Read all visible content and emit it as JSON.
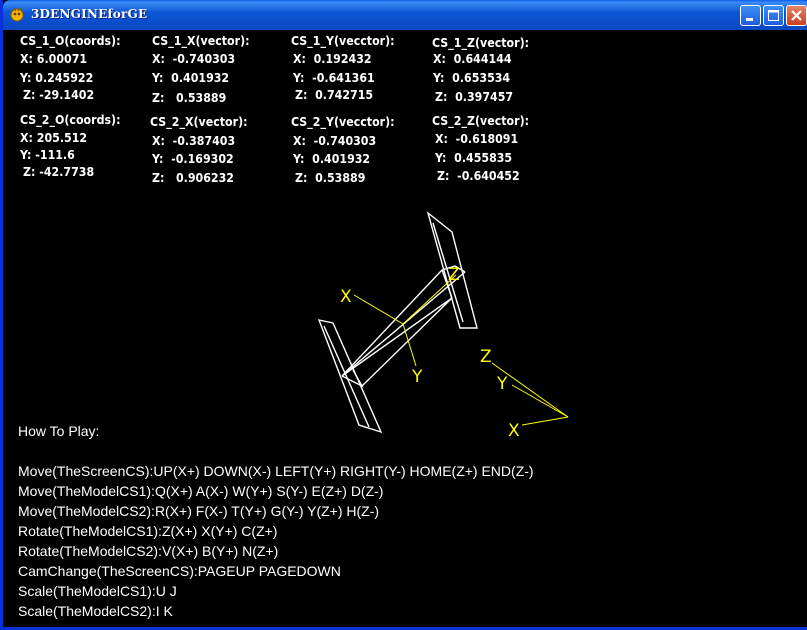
{
  "window": {
    "title": "3DENGINEforGE"
  },
  "colors": {
    "titlebar": "#0a4cc8",
    "background": "#000000",
    "text": "#ffffff",
    "axis": "#ffff00"
  },
  "icons": {
    "app": "game-controller-icon",
    "minimize": "minimize-icon",
    "maximize": "maximize-icon",
    "close": "close-icon"
  },
  "coord_systems": [
    {
      "blocks": [
        {
          "header": "CS_1_O(coords):",
          "rows": [
            {
              "axis": "X:",
              "value": "6.00071"
            },
            {
              "axis": "Y:",
              "value": "0.245922"
            },
            {
              "axis": "Z:",
              "value": "-29.1402"
            }
          ]
        },
        {
          "header": "CS_1_X(vector):",
          "rows": [
            {
              "axis": "X:",
              "value": "-0.740303"
            },
            {
              "axis": "Y:",
              "value": "0.401932"
            },
            {
              "axis": "Z:",
              "value": "0.53889"
            }
          ]
        },
        {
          "header": "CS_1_Y(vecctor):",
          "rows": [
            {
              "axis": "X:",
              "value": "0.192432"
            },
            {
              "axis": "Y:",
              "value": "-0.641361"
            },
            {
              "axis": "Z:",
              "value": "0.742715"
            }
          ]
        },
        {
          "header": "CS_1_Z(vector):",
          "rows": [
            {
              "axis": "X:",
              "value": "0.644144"
            },
            {
              "axis": "Y:",
              "value": "0.653534"
            },
            {
              "axis": "Z:",
              "value": "0.397457"
            }
          ]
        }
      ]
    },
    {
      "blocks": [
        {
          "header": "CS_2_O(coords):",
          "rows": [
            {
              "axis": "X:",
              "value": "205.512"
            },
            {
              "axis": "Y:",
              "value": "-111.6"
            },
            {
              "axis": "Z:",
              "value": "-42.7738"
            }
          ]
        },
        {
          "header": "CS_2_X(vector):",
          "rows": [
            {
              "axis": "X:",
              "value": "-0.387403"
            },
            {
              "axis": "Y:",
              "value": "-0.169302"
            },
            {
              "axis": "Z:",
              "value": "0.906232"
            }
          ]
        },
        {
          "header": "CS_2_Y(vecctor):",
          "rows": [
            {
              "axis": "X:",
              "value": "-0.740303"
            },
            {
              "axis": "Y:",
              "value": "0.401932"
            },
            {
              "axis": "Z:",
              "value": "0.53889"
            }
          ]
        },
        {
          "header": "CS_2_Z(vector):",
          "rows": [
            {
              "axis": "X:",
              "value": "-0.618091"
            },
            {
              "axis": "Y:",
              "value": "0.455835"
            },
            {
              "axis": "Z:",
              "value": "-0.640452"
            }
          ]
        }
      ]
    }
  ],
  "scene": {
    "cs1_axes": {
      "x": "X",
      "y": "Y",
      "z": "Z"
    },
    "cs2_axes": {
      "x": "X",
      "y": "Y",
      "z": "Z"
    }
  },
  "help": {
    "title": "How To Play:",
    "lines": [
      "Move(TheScreenCS):UP(X+) DOWN(X-) LEFT(Y+) RIGHT(Y-) HOME(Z+) END(Z-)",
      "Move(TheModelCS1):Q(X+) A(X-) W(Y+) S(Y-) E(Z+) D(Z-)",
      "Move(TheModelCS2):R(X+) F(X-) T(Y+) G(Y-) Y(Z+) H(Z-)",
      "Rotate(TheModelCS1):Z(X+) X(Y+) C(Z+)",
      "Rotate(TheModelCS2):V(X+) B(Y+) N(Z+)",
      "CamChange(TheScreenCS):PAGEUP PAGEDOWN",
      "Scale(TheModelCS1):U J",
      "Scale(TheModelCS2):I K"
    ]
  }
}
